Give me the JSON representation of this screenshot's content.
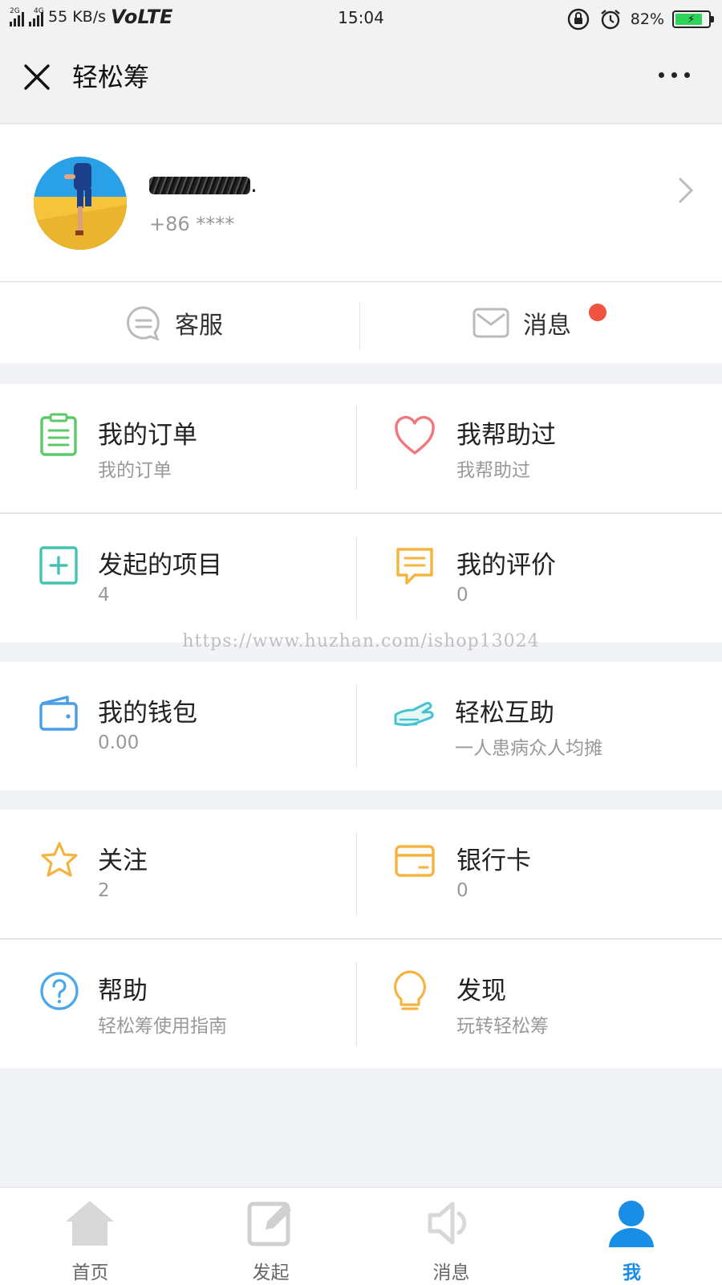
{
  "status_bar": {
    "network1": "2G",
    "network2": "4G",
    "speed": "55 KB/s",
    "volte": "VoLTE",
    "time": "15:04",
    "battery": "82%",
    "battery_level": 0.82
  },
  "nav": {
    "title": "轻松筹"
  },
  "profile": {
    "phone": "+86 ****"
  },
  "service": {
    "customer_service": "客服",
    "messages": "消息"
  },
  "menu": {
    "orders": {
      "title": "我的订单",
      "sub": "我的订单"
    },
    "helped": {
      "title": "我帮助过",
      "sub": "我帮助过"
    },
    "projects": {
      "title": "发起的项目",
      "sub": "4"
    },
    "reviews": {
      "title": "我的评价",
      "sub": "0"
    },
    "wallet": {
      "title": "我的钱包",
      "sub": "0.00"
    },
    "mutual_aid": {
      "title": "轻松互助",
      "sub": "一人患病众人均摊"
    },
    "follow": {
      "title": "关注",
      "sub": "2"
    },
    "bank_card": {
      "title": "银行卡",
      "sub": "0"
    },
    "help": {
      "title": "帮助",
      "sub": "轻松筹使用指南"
    },
    "discover": {
      "title": "发现",
      "sub": "玩转轻松筹"
    }
  },
  "watermark": "https://www.huzhan.com/ishop13024",
  "tabbar": {
    "home": "首页",
    "start": "发起",
    "messages": "消息",
    "me": "我"
  },
  "colors": {
    "accent": "#1a8ee6",
    "green": "#5cc96a",
    "pink": "#f2777c",
    "teal": "#45c3b2",
    "orange": "#f5b33f",
    "blue": "#4a9ee8",
    "badge": "#f0533f"
  }
}
